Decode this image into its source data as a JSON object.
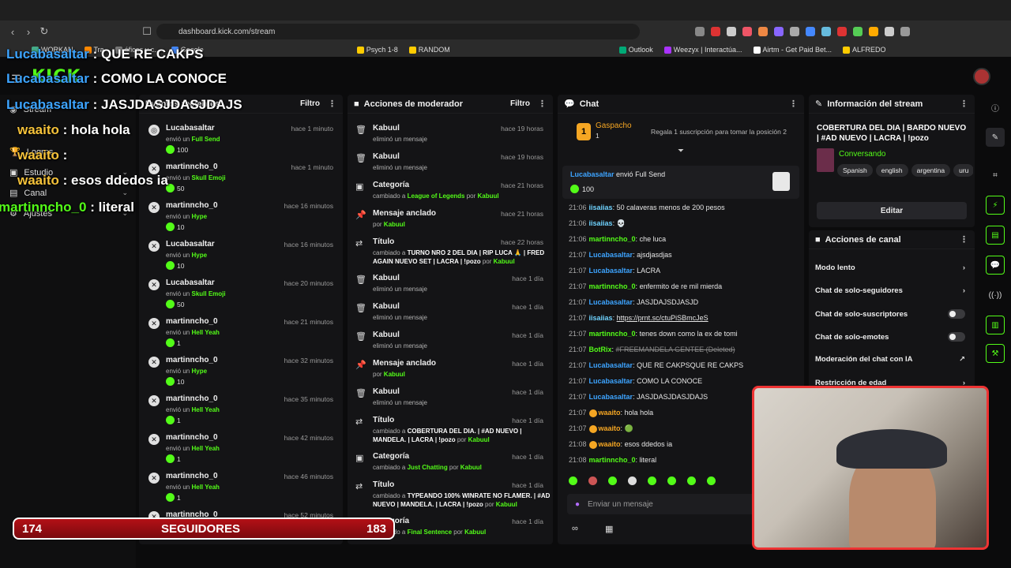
{
  "browser": {
    "url": "dashboard.kick.com/stream",
    "bookmarks": [
      "WORKAN",
      "Tra",
      "áficos y c...",
      "Google",
      "Psych 1-8",
      "RANDOM",
      "Outlook",
      "Weezyx | Interactúa...",
      "Airtm - Get Paid Bet...",
      "ALFREDO"
    ]
  },
  "header": {
    "logo": "KICK"
  },
  "sidebar": {
    "items": [
      {
        "label": "Stream"
      },
      {
        "label": "Logros"
      },
      {
        "label": "Estudio"
      },
      {
        "label": "Canal"
      },
      {
        "label": "Ajustes"
      }
    ]
  },
  "events_panel": {
    "title": "Eventos recientes",
    "filter": "Filtro",
    "items": [
      {
        "user": "Lucabasaltar",
        "time": "hace 1 minuto",
        "pre": "envió un",
        "item": "Full Send",
        "amount": "100"
      },
      {
        "user": "martinncho_0",
        "time": "hace 1 minuto",
        "pre": "envió un",
        "item": "Skull Emoji",
        "amount": "50"
      },
      {
        "user": "martinncho_0",
        "time": "hace 16 minutos",
        "pre": "envió un",
        "item": "Hype",
        "amount": "10"
      },
      {
        "user": "Lucabasaltar",
        "time": "hace 16 minutos",
        "pre": "envió un",
        "item": "Hype",
        "amount": "10"
      },
      {
        "user": "Lucabasaltar",
        "time": "hace 20 minutos",
        "pre": "envió un",
        "item": "Skull Emoji",
        "amount": "50"
      },
      {
        "user": "martinncho_0",
        "time": "hace 21 minutos",
        "pre": "envió un",
        "item": "Hell Yeah",
        "amount": "1"
      },
      {
        "user": "martinncho_0",
        "time": "hace 32 minutos",
        "pre": "envió un",
        "item": "Hype",
        "amount": "10"
      },
      {
        "user": "martinncho_0",
        "time": "hace 35 minutos",
        "pre": "envió un",
        "item": "Hell Yeah",
        "amount": "1"
      },
      {
        "user": "martinncho_0",
        "time": "hace 42 minutos",
        "pre": "envió un",
        "item": "Hell Yeah",
        "amount": "1"
      },
      {
        "user": "martinncho_0",
        "time": "hace 46 minutos",
        "pre": "envió un",
        "item": "Hell Yeah",
        "amount": "1"
      },
      {
        "user": "martinncho_0",
        "time": "hace 52 minutos",
        "pre": "",
        "item": "",
        "amount": ""
      }
    ]
  },
  "mod_panel": {
    "title": "Acciones de moderador",
    "filter": "Filtro",
    "items": [
      {
        "icon": "trash",
        "title": "Kabuul",
        "time": "hace 19 horas",
        "sub": "eliminó un mensaje",
        "val": "",
        "by": ""
      },
      {
        "icon": "trash",
        "title": "Kabuul",
        "time": "hace 19 horas",
        "sub": "eliminó un mensaje",
        "val": "",
        "by": ""
      },
      {
        "icon": "category",
        "title": "Categoría",
        "time": "hace 21 horas",
        "sub": "cambiado a",
        "val": "League of Legends",
        "by": "Kabuul"
      },
      {
        "icon": "pin",
        "title": "Mensaje anclado",
        "time": "hace 21 horas",
        "sub": "por",
        "val": "",
        "by": "Kabuul"
      },
      {
        "icon": "title",
        "title": "Título",
        "time": "hace 22 horas",
        "sub": "cambiado a",
        "val": "TURNO NRO 2 DEL DIA | RIP LUCA 🙏 | FRED AGAIN NUEVO SET | LACRA | !pozo",
        "by": "Kabuul"
      },
      {
        "icon": "trash",
        "title": "Kabuul",
        "time": "hace 1 día",
        "sub": "eliminó un mensaje",
        "val": "",
        "by": ""
      },
      {
        "icon": "trash",
        "title": "Kabuul",
        "time": "hace 1 día",
        "sub": "eliminó un mensaje",
        "val": "",
        "by": ""
      },
      {
        "icon": "trash",
        "title": "Kabuul",
        "time": "hace 1 día",
        "sub": "eliminó un mensaje",
        "val": "",
        "by": ""
      },
      {
        "icon": "pin",
        "title": "Mensaje anclado",
        "time": "hace 1 día",
        "sub": "por",
        "val": "",
        "by": "Kabuul"
      },
      {
        "icon": "trash",
        "title": "Kabuul",
        "time": "hace 1 día",
        "sub": "eliminó un mensaje",
        "val": "",
        "by": ""
      },
      {
        "icon": "title",
        "title": "Título",
        "time": "hace 1 día",
        "sub": "cambiado a",
        "val": "COBERTURA DEL DIA. | #AD NUEVO | MANDELA. | LACRA | !pozo",
        "by": "Kabuul"
      },
      {
        "icon": "category",
        "title": "Categoría",
        "time": "hace 1 día",
        "sub": "cambiado a",
        "val": "Just Chatting",
        "by": "Kabuul"
      },
      {
        "icon": "title",
        "title": "Título",
        "time": "hace 1 día",
        "sub": "cambiado a",
        "val": "TYPEANDO 100% WINRATE NO FLAMER. | #AD NUEVO | MANDELA. | LACRA | !pozo",
        "by": "Kabuul"
      },
      {
        "icon": "category",
        "title": "Categoría",
        "time": "hace 1 día",
        "sub": "cambiado a",
        "val": "Final Sentence",
        "by": "Kabuul"
      }
    ]
  },
  "chat": {
    "title": "Chat",
    "top_gifter": {
      "name": "Gaspacho",
      "count": "1",
      "cta": "Regala 1 suscripción para tomar la posición 2"
    },
    "highlight": {
      "user": "Lucabasaltar",
      "text": "envió Full Send",
      "amount": "100"
    },
    "messages": [
      {
        "time": "21:06",
        "user": "iisaiias",
        "color": "cyan",
        "text": "50 calaveras menos de 200 pesos"
      },
      {
        "time": "21:06",
        "user": "iisaiias",
        "color": "cyan",
        "text": "💀"
      },
      {
        "time": "21:06",
        "user": "martinncho_0",
        "color": "green",
        "text": "che luca"
      },
      {
        "time": "21:07",
        "user": "Lucabasaltar",
        "color": "blue",
        "text": "ajsdjasdjas"
      },
      {
        "time": "21:07",
        "user": "Lucabasaltar",
        "color": "blue",
        "text": "LACRA"
      },
      {
        "time": "21:07",
        "user": "martinncho_0",
        "color": "green",
        "text": "enfermito de re mil mierda"
      },
      {
        "time": "21:07",
        "user": "Lucabasaltar",
        "color": "blue",
        "text": "JASJDAJSDJASJD"
      },
      {
        "time": "21:07",
        "user": "iisaiias",
        "color": "cyan",
        "text": "https://prnt.sc/ctuPiSBmcJeS"
      },
      {
        "time": "21:07",
        "user": "martinncho_0",
        "color": "green",
        "text": "tenes down como la ex de tomi"
      },
      {
        "time": "21:07",
        "user": "BotRix",
        "color": "green",
        "text": "#FREEMANDELA GENTEE (Deleted)"
      },
      {
        "time": "21:07",
        "user": "Lucabasaltar",
        "color": "blue",
        "text": "QUE RE CAKPSQUE RE CAKPS"
      },
      {
        "time": "21:07",
        "user": "Lucabasaltar",
        "color": "blue",
        "text": "COMO LA CONOCE"
      },
      {
        "time": "21:07",
        "user": "Lucabasaltar",
        "color": "blue",
        "text": "JASJDASJDASJDAJS"
      },
      {
        "time": "21:07",
        "user": "waaito",
        "color": "orange",
        "text": "hola hola"
      },
      {
        "time": "21:07",
        "user": "waaito",
        "color": "orange",
        "text": "🟢"
      },
      {
        "time": "21:08",
        "user": "waaito",
        "color": "orange",
        "text": "esos ddedos ia"
      },
      {
        "time": "21:08",
        "user": "martinncho_0",
        "color": "green",
        "text": "literal"
      }
    ],
    "input_placeholder": "Enviar un mensaje"
  },
  "stream_info": {
    "header": "Información del stream",
    "title": "COBERTURA DEL DIA | BARDO NUEVO | #AD NUEVO | LACRA | !pozo",
    "category": "Conversando",
    "tags": [
      "Spanish",
      "english",
      "argentina",
      "uru"
    ],
    "edit": "Editar"
  },
  "channel_actions": {
    "header": "Acciones de canal",
    "items": [
      {
        "label": "Modo lento",
        "control": "arrow"
      },
      {
        "label": "Chat de solo-seguidores",
        "control": "arrow"
      },
      {
        "label": "Chat de solo-suscriptores",
        "control": "toggle"
      },
      {
        "label": "Chat de solo-emotes",
        "control": "toggle"
      },
      {
        "label": "Moderación del chat con IA",
        "control": "link"
      },
      {
        "label": "Restricción de edad",
        "control": "arrow"
      }
    ]
  },
  "overlay": {
    "chat_lines": [
      {
        "user": "Lucabasaltar",
        "text": ": QUE RE CAKPS",
        "color": "blue"
      },
      {
        "user": "Lucabasaltar",
        "text": ": COMO LA CONOCE",
        "color": "blue"
      },
      {
        "user": "Lucabasaltar",
        "text": ": JASJDASJDASJDAJS",
        "color": "blue"
      },
      {
        "user": "waaito",
        "text": ": hola hola",
        "color": "orange"
      },
      {
        "user": "waaito",
        "text": ":",
        "color": "orange"
      },
      {
        "user": "waaito",
        "text": ": esos ddedos ia",
        "color": "orange"
      },
      {
        "user": "martinncho_0",
        "text": ": literal",
        "color": "green"
      }
    ],
    "follow_goal": {
      "current": "174",
      "label": "SEGUIDORES",
      "target": "183"
    }
  },
  "colors": {
    "accent": "#53fc18",
    "bg": "#0b0b0c",
    "panel": "#141416"
  }
}
